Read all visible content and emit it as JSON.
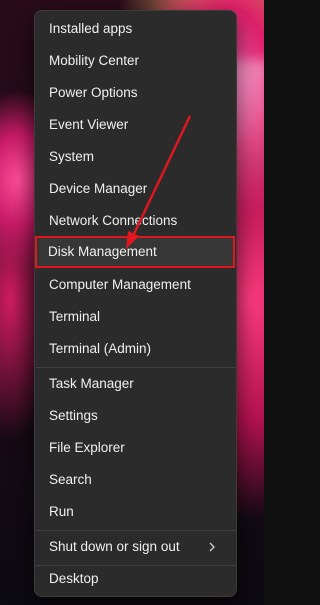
{
  "menu": {
    "items": [
      {
        "label": "Installed apps"
      },
      {
        "label": "Mobility Center"
      },
      {
        "label": "Power Options"
      },
      {
        "label": "Event Viewer"
      },
      {
        "label": "System"
      },
      {
        "label": "Device Manager"
      },
      {
        "label": "Network Connections"
      },
      {
        "label": "Disk Management"
      },
      {
        "label": "Computer Management"
      },
      {
        "label": "Terminal"
      },
      {
        "label": "Terminal (Admin)"
      },
      {
        "label": "Task Manager"
      },
      {
        "label": "Settings"
      },
      {
        "label": "File Explorer"
      },
      {
        "label": "Search"
      },
      {
        "label": "Run"
      },
      {
        "label": "Shut down or sign out",
        "submenu_icon": "chevron-right-icon"
      },
      {
        "label": "Desktop"
      }
    ],
    "highlighted_item": "Disk Management",
    "colors": {
      "menu_background": "#2b2b2b",
      "text": "#f0f0f0",
      "annotation": "#e0171f"
    }
  },
  "annotation": {
    "arrow_icon": "red-arrow-icon",
    "highlight_box": "red-highlight-box"
  }
}
